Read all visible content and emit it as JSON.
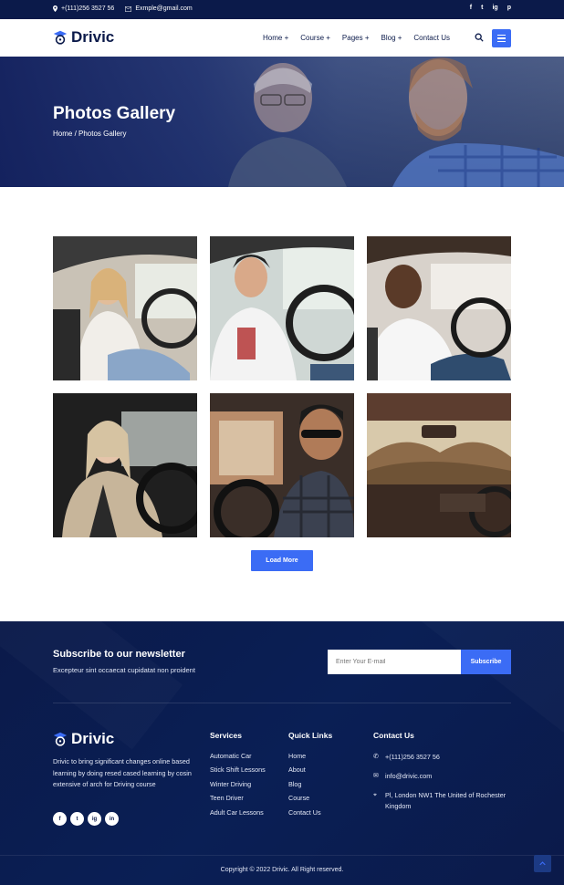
{
  "topbar": {
    "phone": "+(111)256 3527 56",
    "email": "Exmple@gmail.com",
    "social": [
      "f",
      "t",
      "ig",
      "p"
    ]
  },
  "header": {
    "logo_text": "Drivic",
    "nav": [
      "Home +",
      "Course +",
      "Pages +",
      "Blog +",
      "Contact Us"
    ],
    "icons": [
      "search-icon",
      "menu-icon"
    ]
  },
  "hero": {
    "title": "Photos Gallery",
    "breadcrumb": "Home / Photos Gallery"
  },
  "gallery": {
    "items": [
      {
        "label": "woman-driving-phone"
      },
      {
        "label": "young-man-driving"
      },
      {
        "label": "man-in-car"
      },
      {
        "label": "blonde-woman-driving"
      },
      {
        "label": "man-with-sunglasses"
      },
      {
        "label": "car-interior-mountains"
      }
    ],
    "load_more": "Load More"
  },
  "newsletter": {
    "title": "Subscribe to our newsletter",
    "subtitle": "Excepteur sint occaecat cupidatat non proident",
    "placeholder": "Enter Your E-mail",
    "button": "Subscribe"
  },
  "footer": {
    "logo_text": "Drivic",
    "about": "Drivic to bring significant changes online based learning by doing resed cased learning by cosin extensive of arch for Driving course",
    "social": [
      "f",
      "t",
      "ig",
      "in"
    ],
    "services_title": "Services",
    "services": [
      "Automatic Car",
      "Stick Shift Lessons",
      "Winter Driving",
      "Teen Driver",
      "Adult Car Lessons"
    ],
    "links_title": "Quick Links",
    "links": [
      "Home",
      "About",
      "Blog",
      "Course",
      "Contact Us"
    ],
    "contact_title": "Contact Us",
    "contact_phone": "+(111)256 3527 56",
    "contact_email": "info@drivic.com",
    "contact_address": "Pl, London NW1 The United of Rochester Kingdom",
    "copyright": "Copyright © 2022 Drivic. All Right reserved."
  },
  "colors": {
    "navy": "#0b1a4a",
    "accent": "#3b6cf5"
  }
}
